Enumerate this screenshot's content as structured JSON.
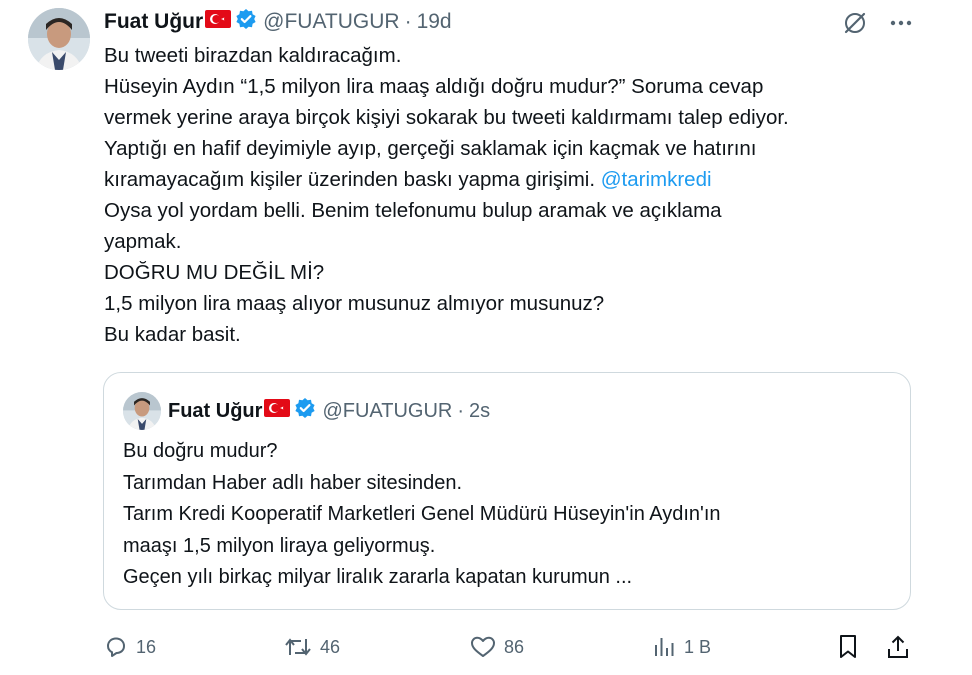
{
  "tweet": {
    "author_name": "Fuat Uğur",
    "handle": "@FUATUGUR",
    "separator": "·",
    "time": "19d",
    "more_label": "···",
    "lines": [
      "Bu tweeti birazdan kaldıracağım.",
      "Hüseyin Aydın “1,5 milyon lira maaş aldığı doğru mudur?”  Soruma cevap",
      "vermek yerine araya birçok kişiyi sokarak bu tweeti kaldırmamı talep ediyor.",
      "Yaptığı en hafif deyimiyle ayıp, gerçeği saklamak için kaçmak ve hatırını"
    ],
    "line5_text": "kıramayacağım kişiler üzerinden baskı yapma girişimi.",
    "mention": "@tarimkredi",
    "lines_after": [
      "Oysa yol yordam belli. Benim telefonumu bulup aramak ve açıklama",
      "yapmak.",
      "DOĞRU MU DEĞİL Mİ?",
      "1,5 milyon lira maaş alıyor musunuz almıyor musunuz?",
      "Bu kadar basit."
    ]
  },
  "quote": {
    "author_name": "Fuat Uğur",
    "handle": "@FUATUGUR",
    "separator": "·",
    "time": "2s",
    "lines": [
      "Bu doğru mudur?",
      "Tarımdan Haber adlı haber sitesinden.",
      "Tarım Kredi Kooperatif Marketleri Genel Müdürü Hüseyin'in Aydın'ın",
      "maaşı 1,5 milyon liraya geliyormuş.",
      "Geçen yılı birkaç milyar liralık zararla kapatan kurumun ..."
    ]
  },
  "actions": {
    "replies": "16",
    "retweets": "46",
    "likes": "86",
    "views": "1 B"
  },
  "colors": {
    "text": "#0f1419",
    "secondary": "#536471",
    "link": "#1d9bf0",
    "verified": "#1d9bf0",
    "flag": "#e30a17",
    "border": "#cfd9de"
  },
  "icons": {
    "verified": "verified-badge-icon",
    "flag": "turkey-flag-icon",
    "grok": "grok-icon",
    "more": "more-icon",
    "reply": "reply-icon",
    "retweet": "retweet-icon",
    "like": "heart-icon",
    "views": "views-icon",
    "bookmark": "bookmark-icon",
    "share": "share-icon"
  }
}
